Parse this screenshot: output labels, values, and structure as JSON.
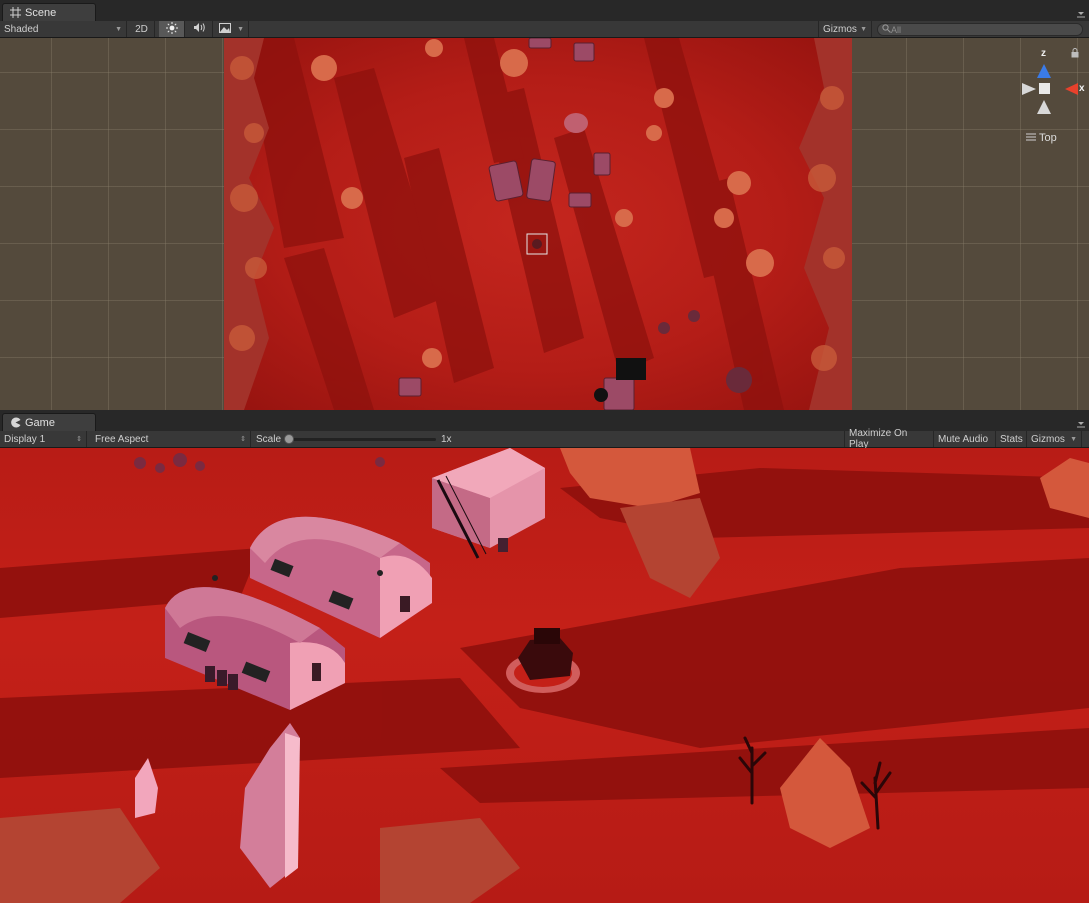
{
  "scene": {
    "tab_label": "Scene",
    "tab_icon": "grid-icon",
    "shading_mode": "Shaded",
    "toggle_2d": "2D",
    "lighting_icon": "sun-icon",
    "audio_icon": "speaker-icon",
    "effects_icon": "image-icon",
    "gizmos_label": "Gizmos",
    "search_placeholder": "All",
    "gizmo": {
      "axis_z": "z",
      "axis_x": "x",
      "view_label": "Top"
    }
  },
  "game": {
    "tab_label": "Game",
    "tab_icon": "pacman-icon",
    "display": "Display 1",
    "aspect": "Free Aspect",
    "scale_label": "Scale",
    "scale_value": "1x",
    "scale_fraction": 0,
    "maximize_on_play": "Maximize On Play",
    "mute_audio": "Mute Audio",
    "stats": "Stats",
    "gizmos": "Gizmos"
  },
  "colors": {
    "editor_bg": "#383838",
    "scene_ground": "#b41d17",
    "scene_grid_bg": "#544a3c",
    "game_ground": "#c42018",
    "gizmo_x": "#e8412c",
    "gizmo_z": "#3a7be8"
  }
}
